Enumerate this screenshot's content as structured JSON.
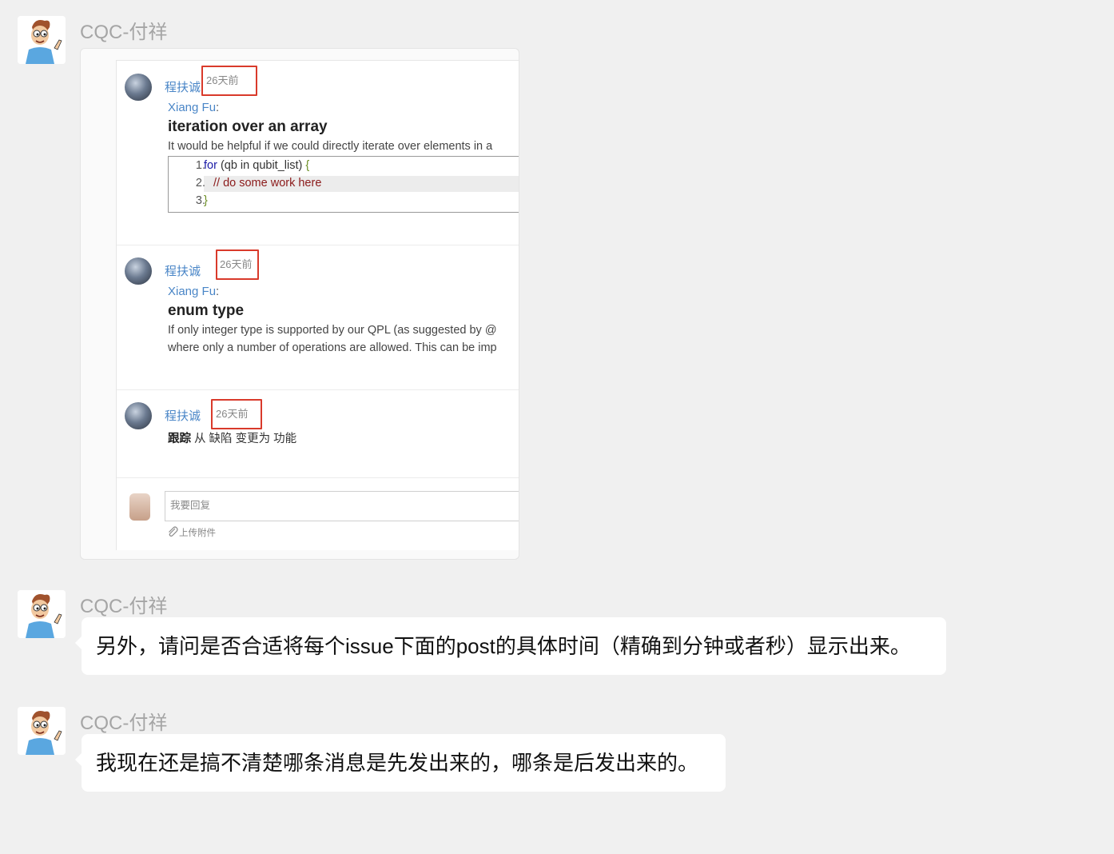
{
  "messages": [
    {
      "sender": "CQC-付祥",
      "type": "image",
      "screenshot": {
        "posts": [
          {
            "user": "程扶诚",
            "time": "26天前",
            "quote_name": "Xiang Fu",
            "quote_colon": ":",
            "title": "iteration over an array",
            "text": "It would be helpful if we could directly iterate over elements in a",
            "code": [
              {
                "num": "1.",
                "kw": "for",
                "rest": " (qb in qubit_list) ",
                "brace": "{"
              },
              {
                "num": "2.",
                "comment": "// do some work here"
              },
              {
                "num": "3.",
                "brace": "}"
              }
            ]
          },
          {
            "user": "程扶诚",
            "time": "26天前",
            "quote_name": "Xiang Fu",
            "quote_colon": ":",
            "title": "enum type",
            "text_line1": "If only integer type is supported by our QPL (as suggested by @",
            "text_line2": "where only a number of operations are allowed. This can be imp"
          },
          {
            "user": "程扶诚",
            "time": "26天前",
            "track_label": "跟踪",
            "track_text": " 从 缺陷 变更为 功能"
          }
        ],
        "reply_placeholder": "我要回复",
        "upload_label": "上传附件"
      }
    },
    {
      "sender": "CQC-付祥",
      "type": "text",
      "text": "另外，请问是否合适将每个issue下面的post的具体时间（精确到分钟或者秒）显示出来。"
    },
    {
      "sender": "CQC-付祥",
      "type": "text",
      "text": "我现在还是搞不清楚哪条消息是先发出来的，哪条是后发出来的。"
    }
  ],
  "colors": {
    "background": "#f0f0f0",
    "bubble": "#ffffff",
    "link": "#4a86c7",
    "highlight_box": "#d93a2b"
  }
}
